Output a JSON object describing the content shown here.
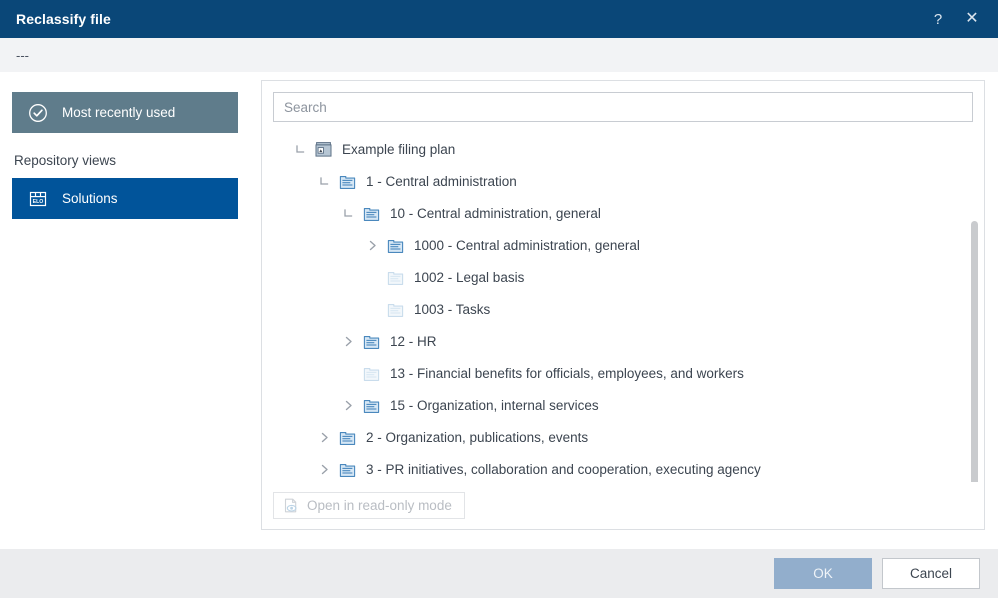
{
  "window": {
    "title": "Reclassify file",
    "help_icon": "help-question-icon",
    "close_icon": "close-icon",
    "subheader_text": "---"
  },
  "colors": {
    "titlebar": "#0a4778",
    "accent_selected": "#01549a",
    "accent_muted": "#5f7c8b",
    "ok_button": "#92aecc",
    "footer": "#ebecee",
    "subheader": "#f2f3f5"
  },
  "sidebar": {
    "items": [
      {
        "label": "Most recently used",
        "icon": "check-circle-icon",
        "state": "highlighted"
      },
      {
        "label": "Solutions",
        "icon": "elo-archive-icon",
        "state": "selected"
      }
    ],
    "section_label": "Repository views"
  },
  "search": {
    "placeholder": "Search",
    "value": ""
  },
  "tree": {
    "nodes": [
      {
        "label": "Example filing plan",
        "depth": 0,
        "toggle": "expanded",
        "icon": "archive-icon"
      },
      {
        "label": "1 - Central administration",
        "depth": 1,
        "toggle": "expanded",
        "icon": "register-icon"
      },
      {
        "label": "10 - Central administration, general",
        "depth": 2,
        "toggle": "expanded",
        "icon": "register-icon"
      },
      {
        "label": "1000 - Central administration, general",
        "depth": 3,
        "toggle": "collapsed",
        "icon": "register-icon"
      },
      {
        "label": "1002 - Legal basis",
        "depth": 3,
        "toggle": "none",
        "icon": "register-icon-faded"
      },
      {
        "label": "1003 - Tasks",
        "depth": 3,
        "toggle": "none",
        "icon": "register-icon-faded"
      },
      {
        "label": "12 - HR",
        "depth": 2,
        "toggle": "collapsed",
        "icon": "register-icon"
      },
      {
        "label": "13 - Financial benefits for officials, employees, and workers",
        "depth": 2,
        "toggle": "none",
        "icon": "register-icon-faded"
      },
      {
        "label": "15 - Organization, internal services",
        "depth": 2,
        "toggle": "collapsed",
        "icon": "register-icon"
      },
      {
        "label": "2 - Organization, publications, events",
        "depth": 1,
        "toggle": "collapsed",
        "icon": "register-icon"
      },
      {
        "label": "3 - PR initiatives, collaboration and cooperation, executing agency",
        "depth": 1,
        "toggle": "collapsed",
        "icon": "register-icon"
      }
    ],
    "readonly_button": {
      "label": "Open in read-only mode",
      "icon": "document-preview-icon",
      "disabled": true
    }
  },
  "footer": {
    "ok_label": "OK",
    "cancel_label": "Cancel"
  }
}
